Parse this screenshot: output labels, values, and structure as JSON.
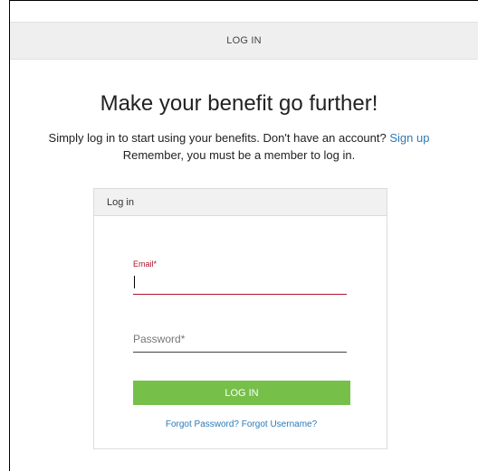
{
  "header": {
    "title": "LOG IN"
  },
  "hero": {
    "headline": "Make your benefit go further!",
    "intro_text": "Simply log in to start using your benefits. Don't have an account?",
    "signup_link": "Sign up",
    "reminder": "Remember, you must be a member to log in."
  },
  "login_card": {
    "title": "Log in",
    "email_label": "Email*",
    "email_value": "",
    "password_placeholder": "Password*",
    "submit_label": "LOG IN",
    "forgot_password": "Forgot Password?",
    "forgot_username": "Forgot Username?"
  },
  "colors": {
    "accent_green": "#76c04a",
    "link_blue": "#2a7ab8",
    "error_red": "#b0132b"
  }
}
